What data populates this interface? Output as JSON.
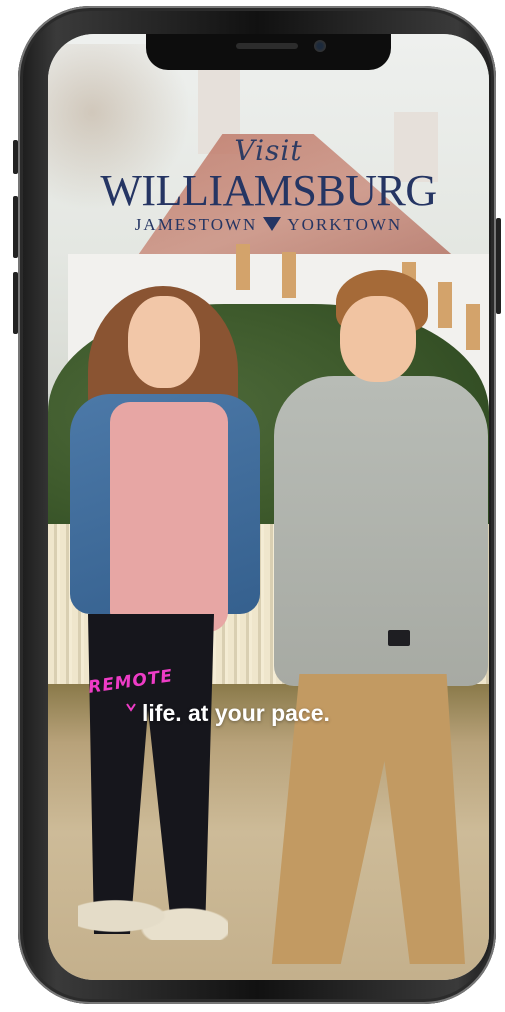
{
  "logo": {
    "visit": "Visit",
    "main": "WILLIAMSBURG",
    "sub_left": "JAMESTOWN",
    "sub_right": "YORKTOWN"
  },
  "tagline": {
    "accent": "REMOTE",
    "text": "life. at your pace."
  },
  "colors": {
    "brand_navy": "#253563",
    "accent_pink": "#ee3cc6"
  },
  "icons": [
    "triangle-down-icon",
    "caret-icon"
  ]
}
